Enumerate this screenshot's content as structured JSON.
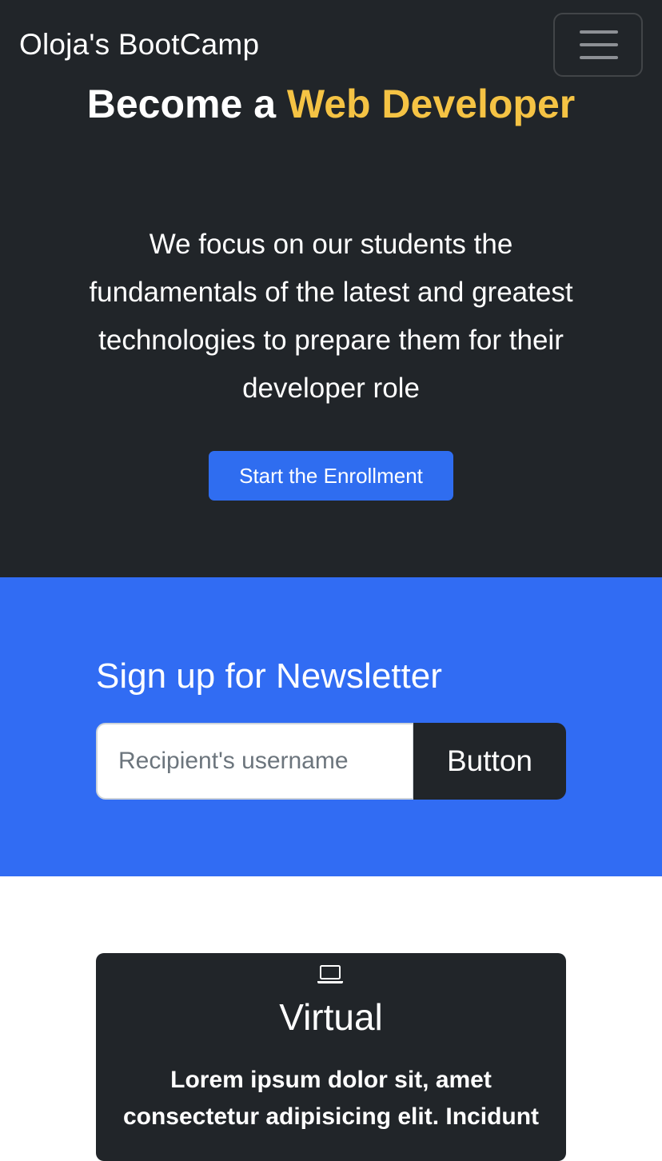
{
  "navbar": {
    "brand": "Oloja's BootCamp",
    "toggler_icon": "hamburger-menu-icon"
  },
  "hero": {
    "title_lead": "Become a",
    "title_accent": "Web Developer",
    "lead": "We focus on our students the fundamentals of the latest and greatest technologies to prepare them for their developer role",
    "cta_label": "Start the Enrollment"
  },
  "newsletter": {
    "title": "Sign up for Newsletter",
    "input_placeholder": "Recipient's username",
    "input_value": "",
    "button_label": "Button"
  },
  "cards": [
    {
      "icon": "laptop-icon",
      "title": "Virtual",
      "text": "Lorem ipsum dolor sit, amet consectetur adipisicing elit. Incidunt"
    }
  ],
  "colors": {
    "dark": "#212529",
    "accent_yellow": "#f5c344",
    "primary_blue": "#316cf3",
    "white": "#ffffff"
  }
}
